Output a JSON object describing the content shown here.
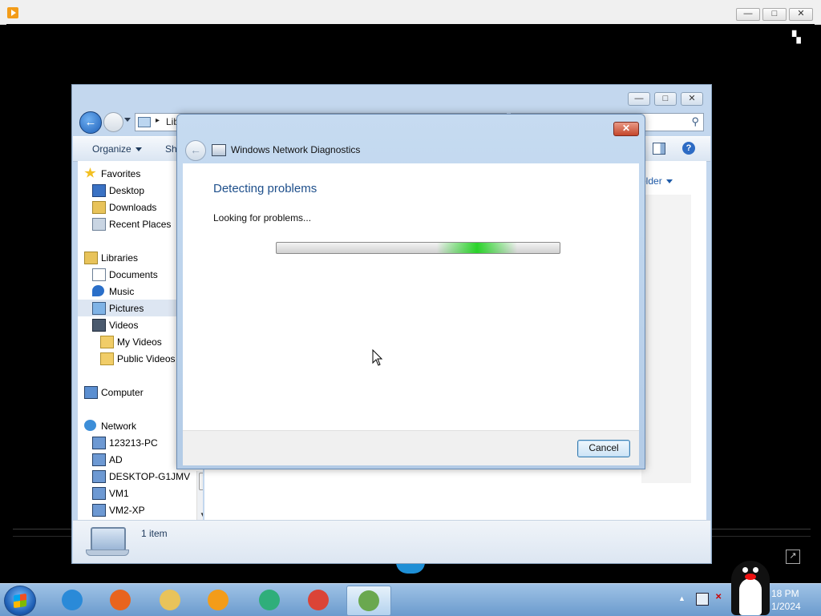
{
  "player": {
    "close_glyph": "✕",
    "max_glyph": "□",
    "min_glyph": "—"
  },
  "explorer": {
    "address_sep": "▸",
    "address_text": "Lib",
    "toolbar": {
      "organize_label": "Organize",
      "share_label": "Sha",
      "new_folder_label": "older"
    },
    "nav_items": [
      {
        "label": "Favorites",
        "icon": "star-icon"
      },
      {
        "label": "Desktop",
        "icon": "desktop-icon"
      },
      {
        "label": "Downloads",
        "icon": "downloads-folder-icon"
      },
      {
        "label": "Recent Places",
        "icon": "recent-places-icon"
      },
      {
        "label": "Libraries",
        "icon": "libraries-icon"
      },
      {
        "label": "Documents",
        "icon": "documents-icon"
      },
      {
        "label": "Music",
        "icon": "music-icon"
      },
      {
        "label": "Pictures",
        "icon": "pictures-icon"
      },
      {
        "label": "Videos",
        "icon": "videos-icon"
      },
      {
        "label": "My Videos",
        "icon": "folder-icon"
      },
      {
        "label": "Public Videos",
        "icon": "folder-icon"
      },
      {
        "label": "Computer",
        "icon": "computer-icon"
      },
      {
        "label": "Network",
        "icon": "network-icon"
      },
      {
        "label": "123213-PC",
        "icon": "network-computer-icon"
      },
      {
        "label": "AD",
        "icon": "network-computer-icon"
      },
      {
        "label": "DESKTOP-G1JMV",
        "icon": "network-computer-icon"
      },
      {
        "label": "VM1",
        "icon": "network-computer-icon"
      },
      {
        "label": "VM2-XP",
        "icon": "network-computer-icon"
      }
    ],
    "selected_item": "Pictures",
    "status_text": "1 item"
  },
  "dialog": {
    "title": "Windows Network Diagnostics",
    "heading": "Detecting problems",
    "status": "Looking for problems...",
    "cancel_label": "Cancel",
    "close_glyph": "✕"
  },
  "taskbar": {
    "apps": [
      {
        "name": "internet-explorer",
        "color": "#2a8ad8"
      },
      {
        "name": "firefox",
        "color": "#e8641e"
      },
      {
        "name": "file-explorer",
        "color": "#e8c35a"
      },
      {
        "name": "media-player",
        "color": "#f39c19"
      },
      {
        "name": "player-app",
        "color": "#2fae7a"
      },
      {
        "name": "chrome",
        "color": "#db4437"
      },
      {
        "name": "network-diagnostics",
        "color": "#6aa84f"
      }
    ],
    "clock_time": "18 PM",
    "clock_date": "1/2024"
  }
}
